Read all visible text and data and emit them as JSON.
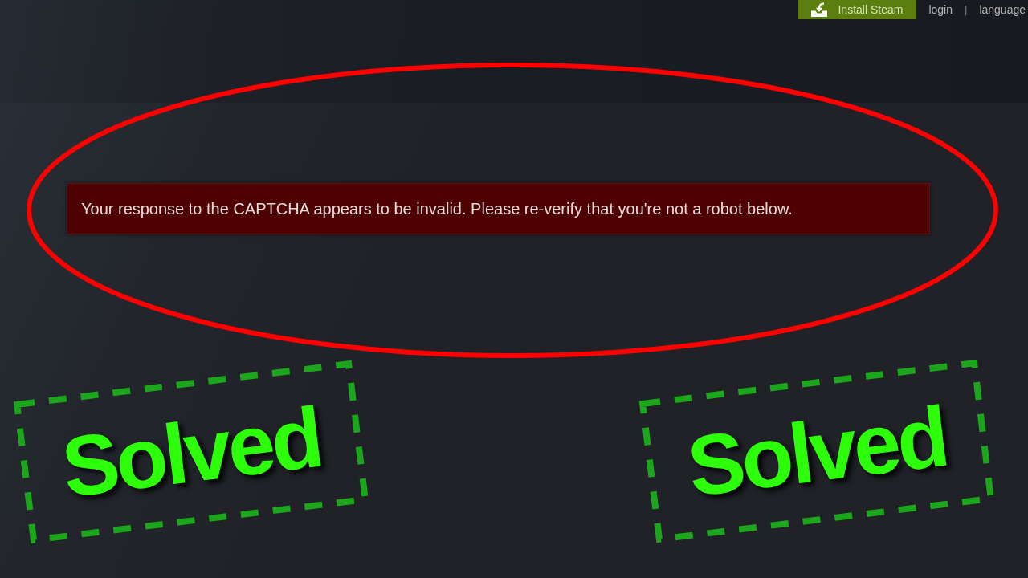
{
  "header": {
    "install_button": {
      "label": "Install Steam"
    },
    "links": [
      {
        "label": "login"
      },
      {
        "label": "language"
      }
    ],
    "separator": "|"
  },
  "error_banner": {
    "message": "Your response to the CAPTCHA appears to be invalid. Please re-verify that you're not a robot below."
  },
  "stickers": [
    {
      "text": "Solved"
    },
    {
      "text": "Solved"
    }
  ]
}
